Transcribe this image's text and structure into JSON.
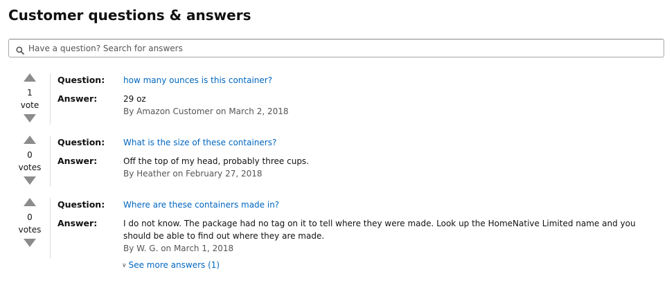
{
  "header": {
    "title": "Customer questions & answers"
  },
  "search": {
    "placeholder": "Have a question? Search for answers",
    "value": "",
    "icon": "search-icon"
  },
  "labels": {
    "question": "Question:",
    "answer": "Answer:"
  },
  "items": [
    {
      "votes": "1",
      "vote_label": "vote",
      "question": "how many ounces is this container?",
      "answer": "29 oz",
      "byline": "By Amazon Customer on March 2, 2018"
    },
    {
      "votes": "0",
      "vote_label": "votes",
      "question": "What is the size of these containers?",
      "answer": "Off the top of my head, probably three cups.",
      "byline": "By Heather on February 27, 2018"
    },
    {
      "votes": "0",
      "vote_label": "votes",
      "question": "Where are these containers made in?",
      "answer": "I do not know. The package had no tag on it to tell where they were made. Look up the HomeNative Limited name and you should be able to find out where they are made.",
      "byline": "By W. G. on March 1, 2018",
      "see_more": "See more answers (1)"
    }
  ],
  "colors": {
    "link": "#0066c0",
    "text": "#111111",
    "muted": "#555555",
    "vote_arrow": "#8c8c8c",
    "divider": "#dddddd"
  }
}
